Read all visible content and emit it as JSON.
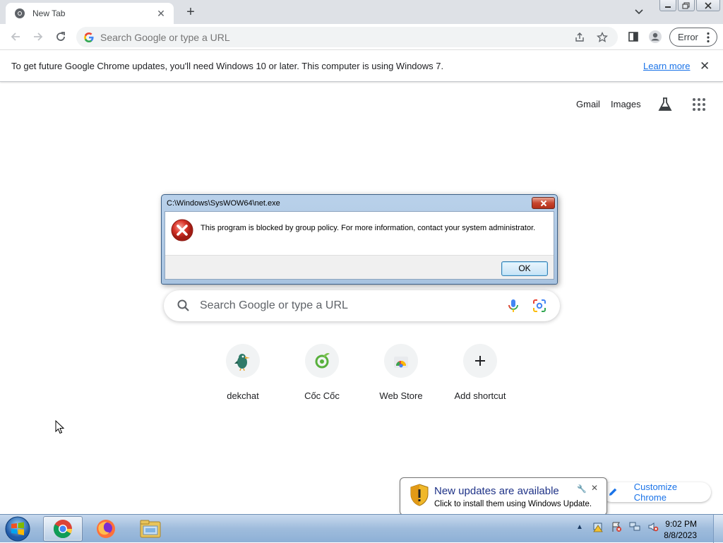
{
  "browser": {
    "tab": {
      "title": "New Tab"
    },
    "toolbar": {
      "omnibox_placeholder": "Search Google or type a URL",
      "profile_error_label": "Error"
    },
    "infobar": {
      "message": "To get future Google Chrome updates, you'll need Windows 10 or later. This computer is using Windows 7.",
      "link": "Learn more"
    }
  },
  "ntp": {
    "header_links": {
      "gmail": "Gmail",
      "images": "Images"
    },
    "search_placeholder": "Search Google or type a URL",
    "shortcuts": [
      {
        "label": "dekchat",
        "icon": "dekchat-bird-icon"
      },
      {
        "label": "Cốc Cốc",
        "icon": "coccoc-icon"
      },
      {
        "label": "Web Store",
        "icon": "web-store-icon"
      },
      {
        "label": "Add shortcut",
        "icon": "plus-icon"
      }
    ],
    "customize_label": "Customize Chrome"
  },
  "dialog": {
    "title": "C:\\Windows\\SysWOW64\\net.exe",
    "message": "This program is blocked by group policy. For more information, contact your system administrator.",
    "ok_label": "OK"
  },
  "balloon": {
    "title": "New updates are available",
    "subtitle": "Click to install them using Windows Update."
  },
  "taskbar": {
    "apps": [
      "chrome-icon",
      "firefox-icon",
      "file-explorer-icon"
    ],
    "clock_time": "9:02 PM",
    "clock_date": "8/8/2023"
  },
  "colors": {
    "accent": "#1a73e8",
    "error_red": "#c7452e",
    "taskbar_blue": "#9fbcdc"
  }
}
